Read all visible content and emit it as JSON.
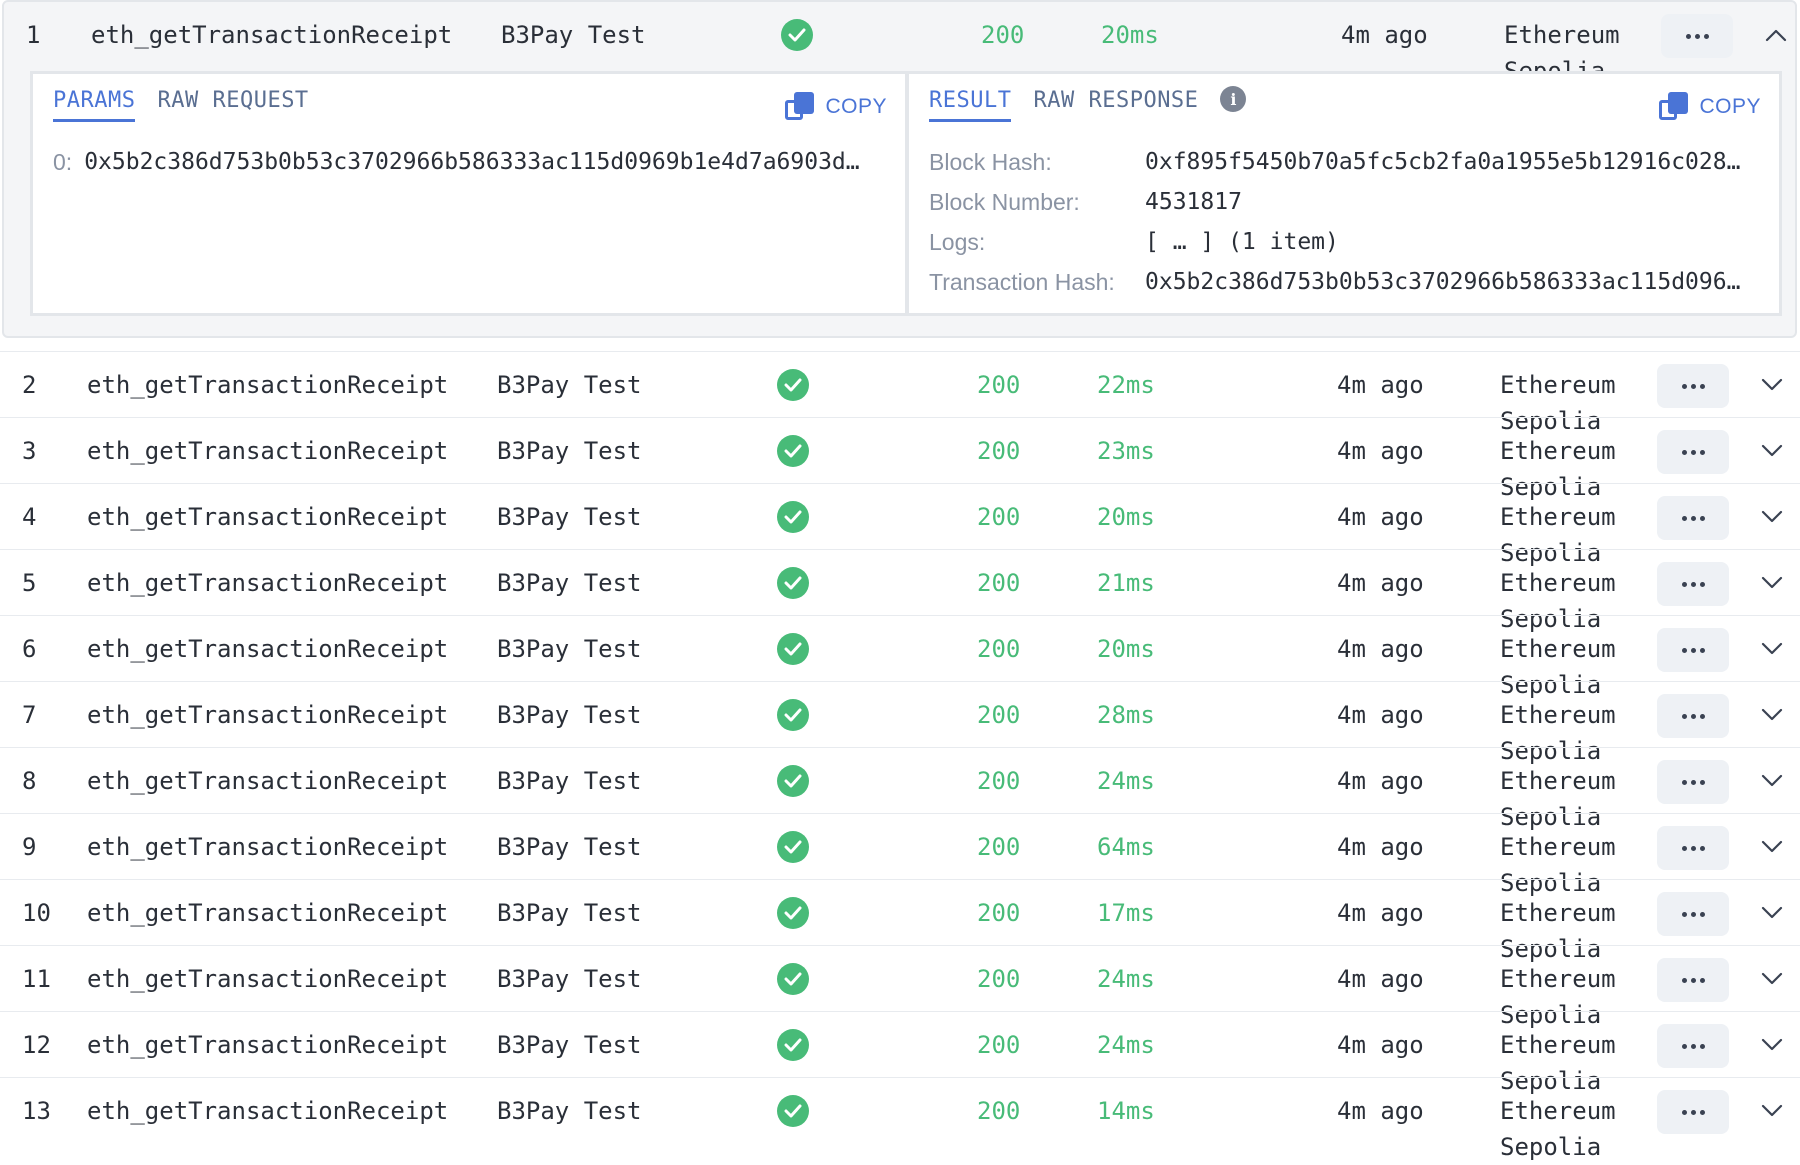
{
  "rows": [
    {
      "num": "1",
      "method": "eth_getTransactionReceipt",
      "project": "B3Pay Test",
      "code": "200",
      "latency": "20ms",
      "ago": "4m ago",
      "network_line1": "Ethereum",
      "network_line2": "Sepolia",
      "expanded": true
    },
    {
      "num": "2",
      "method": "eth_getTransactionReceipt",
      "project": "B3Pay Test",
      "code": "200",
      "latency": "22ms",
      "ago": "4m ago",
      "network_line1": "Ethereum",
      "network_line2": "Sepolia"
    },
    {
      "num": "3",
      "method": "eth_getTransactionReceipt",
      "project": "B3Pay Test",
      "code": "200",
      "latency": "23ms",
      "ago": "4m ago",
      "network_line1": "Ethereum",
      "network_line2": "Sepolia"
    },
    {
      "num": "4",
      "method": "eth_getTransactionReceipt",
      "project": "B3Pay Test",
      "code": "200",
      "latency": "20ms",
      "ago": "4m ago",
      "network_line1": "Ethereum",
      "network_line2": "Sepolia"
    },
    {
      "num": "5",
      "method": "eth_getTransactionReceipt",
      "project": "B3Pay Test",
      "code": "200",
      "latency": "21ms",
      "ago": "4m ago",
      "network_line1": "Ethereum",
      "network_line2": "Sepolia"
    },
    {
      "num": "6",
      "method": "eth_getTransactionReceipt",
      "project": "B3Pay Test",
      "code": "200",
      "latency": "20ms",
      "ago": "4m ago",
      "network_line1": "Ethereum",
      "network_line2": "Sepolia"
    },
    {
      "num": "7",
      "method": "eth_getTransactionReceipt",
      "project": "B3Pay Test",
      "code": "200",
      "latency": "28ms",
      "ago": "4m ago",
      "network_line1": "Ethereum",
      "network_line2": "Sepolia"
    },
    {
      "num": "8",
      "method": "eth_getTransactionReceipt",
      "project": "B3Pay Test",
      "code": "200",
      "latency": "24ms",
      "ago": "4m ago",
      "network_line1": "Ethereum",
      "network_line2": "Sepolia"
    },
    {
      "num": "9",
      "method": "eth_getTransactionReceipt",
      "project": "B3Pay Test",
      "code": "200",
      "latency": "64ms",
      "ago": "4m ago",
      "network_line1": "Ethereum",
      "network_line2": "Sepolia"
    },
    {
      "num": "10",
      "method": "eth_getTransactionReceipt",
      "project": "B3Pay Test",
      "code": "200",
      "latency": "17ms",
      "ago": "4m ago",
      "network_line1": "Ethereum",
      "network_line2": "Sepolia"
    },
    {
      "num": "11",
      "method": "eth_getTransactionReceipt",
      "project": "B3Pay Test",
      "code": "200",
      "latency": "24ms",
      "ago": "4m ago",
      "network_line1": "Ethereum",
      "network_line2": "Sepolia"
    },
    {
      "num": "12",
      "method": "eth_getTransactionReceipt",
      "project": "B3Pay Test",
      "code": "200",
      "latency": "24ms",
      "ago": "4m ago",
      "network_line1": "Ethereum",
      "network_line2": "Sepolia"
    },
    {
      "num": "13",
      "method": "eth_getTransactionReceipt",
      "project": "B3Pay Test",
      "code": "200",
      "latency": "14ms",
      "ago": "4m ago",
      "network_line1": "Ethereum",
      "network_line2": "Sepolia"
    }
  ],
  "details": {
    "left_tabs": [
      "PARAMS",
      "RAW REQUEST"
    ],
    "right_tabs": [
      "RESULT",
      "RAW RESPONSE"
    ],
    "copy_label": "COPY",
    "params": [
      {
        "key": "0:",
        "value": "0x5b2c386d753b0b53c3702966b586333ac115d0969b1e4d7a6903d…"
      }
    ],
    "result": [
      {
        "key": "Block Hash:",
        "value": "0xf895f5450b70a5fc5cb2fa0a1955e5b12916c028…"
      },
      {
        "key": "Block Number:",
        "value": "4531817"
      },
      {
        "key": "Logs:",
        "value": "[ … ] (1 item)"
      },
      {
        "key": "Transaction Hash:",
        "value": "0x5b2c386d753b0b53c3702966b586333ac115d096…"
      }
    ]
  },
  "colors": {
    "success": "#48bb78",
    "accent": "#4a74d6"
  },
  "icons": {
    "status": "check-circle-icon",
    "more": "ellipsis-icon",
    "expand": "chevron-down-icon",
    "collapse": "chevron-up-icon",
    "copy": "copy-icon",
    "info": "info-icon"
  }
}
